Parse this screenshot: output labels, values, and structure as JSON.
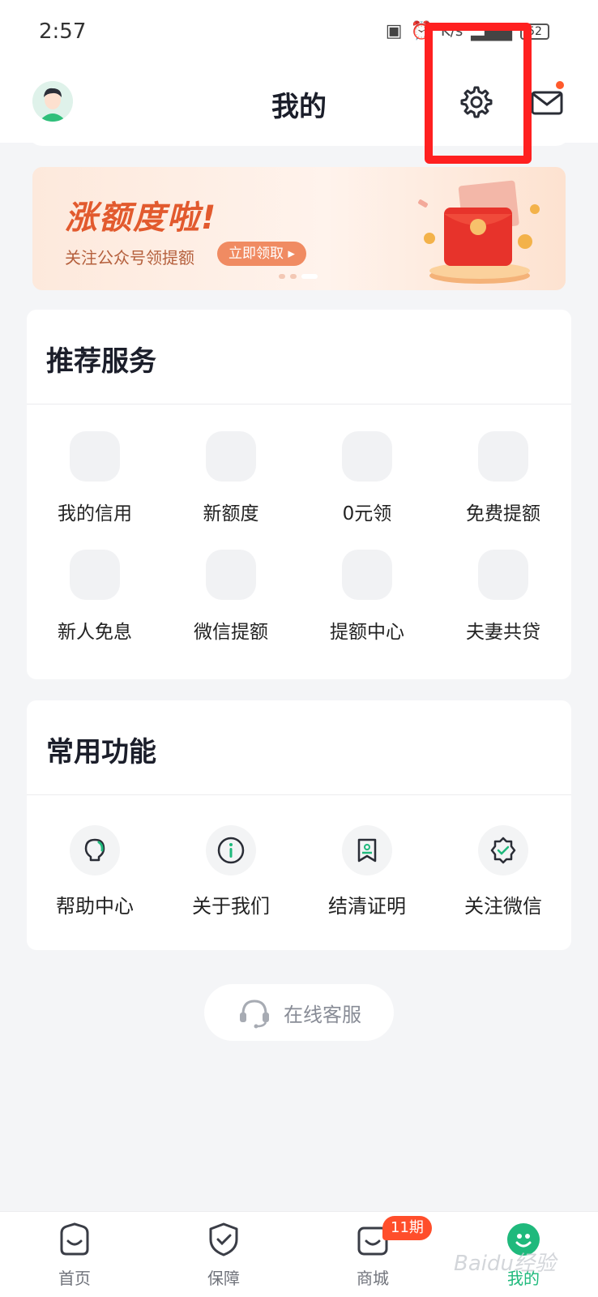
{
  "status_bar": {
    "time": "2:57",
    "speed": "K/s",
    "battery": "52"
  },
  "header": {
    "title": "我的"
  },
  "banner": {
    "title": "涨额度啦!",
    "subtitle": "关注公众号领提额",
    "button_label": "立即领取"
  },
  "services": {
    "title": "推荐服务",
    "items": [
      {
        "label": "我的信用"
      },
      {
        "label": "新额度"
      },
      {
        "label": "0元领"
      },
      {
        "label": "免费提额"
      },
      {
        "label": "新人免息"
      },
      {
        "label": "微信提额"
      },
      {
        "label": "提额中心"
      },
      {
        "label": "夫妻共贷"
      }
    ]
  },
  "functions": {
    "title": "常用功能",
    "items": [
      {
        "label": "帮助中心",
        "icon": "lightbulb-icon"
      },
      {
        "label": "关于我们",
        "icon": "info-icon"
      },
      {
        "label": "结清证明",
        "icon": "certificate-icon"
      },
      {
        "label": "关注微信",
        "icon": "verified-badge-icon"
      }
    ]
  },
  "online_service": {
    "label": "在线客服",
    "icon": "headset-icon"
  },
  "tabbar": {
    "items": [
      {
        "label": "首页",
        "icon": "home-icon"
      },
      {
        "label": "保障",
        "icon": "shield-check-icon"
      },
      {
        "label": "商城",
        "icon": "mall-icon"
      },
      {
        "label": "我的",
        "icon": "profile-icon",
        "active": true
      }
    ],
    "mall_badge": "11期"
  },
  "watermark": "Baidu经验",
  "colors": {
    "accent": "#1fb97c",
    "highlight": "#ff2020",
    "badge": "#ff4e2b",
    "banner_text": "#e25a2e"
  }
}
